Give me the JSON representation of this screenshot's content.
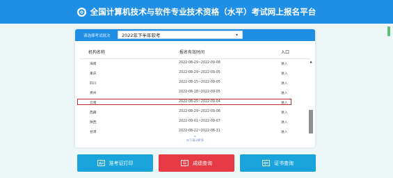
{
  "header": {
    "title": "全国计算机技术与软件专业技术资格（水平）考试网上报名平台"
  },
  "exam_select": {
    "label": "请选择考试批次",
    "selected": "2022年下半年软考"
  },
  "table": {
    "columns": [
      "机构名称",
      "报名有效时间",
      "入口"
    ],
    "rows": [
      {
        "name": "海南",
        "time": "2022-08-29~2022-09-08",
        "entry": "进入"
      },
      {
        "name": "重庆",
        "time": "2022-08-29~2022-09-05",
        "entry": "进入"
      },
      {
        "name": "四川",
        "time": "2022-08-15~2022-09-05",
        "entry": "进入"
      },
      {
        "name": "贵州",
        "time": "2022-08-18~2022-09-05",
        "entry": "进入"
      },
      {
        "name": "云南",
        "time": "2022-08-25~2022-09-04",
        "entry": "进入"
      },
      {
        "name": "西藏",
        "time": "2022-08-29~2022-09-06",
        "entry": "进入"
      },
      {
        "name": "陕西",
        "time": "2022-09-01~2022-09-07",
        "entry": "进入"
      },
      {
        "name": "甘肃",
        "time": "2022-08-22~2022-08-31",
        "entry": "进入"
      }
    ],
    "highlighted_row": 4,
    "more_text": "向下滚动更多"
  },
  "buttons": {
    "admission": "准考证打印",
    "scores": "成绩查询",
    "certificate": "证书查询"
  },
  "colors": {
    "header_blue": "#1f8fe6",
    "button_blue": "#19a4dc",
    "button_red": "#e63a45",
    "highlight_border": "#c02a2a"
  }
}
